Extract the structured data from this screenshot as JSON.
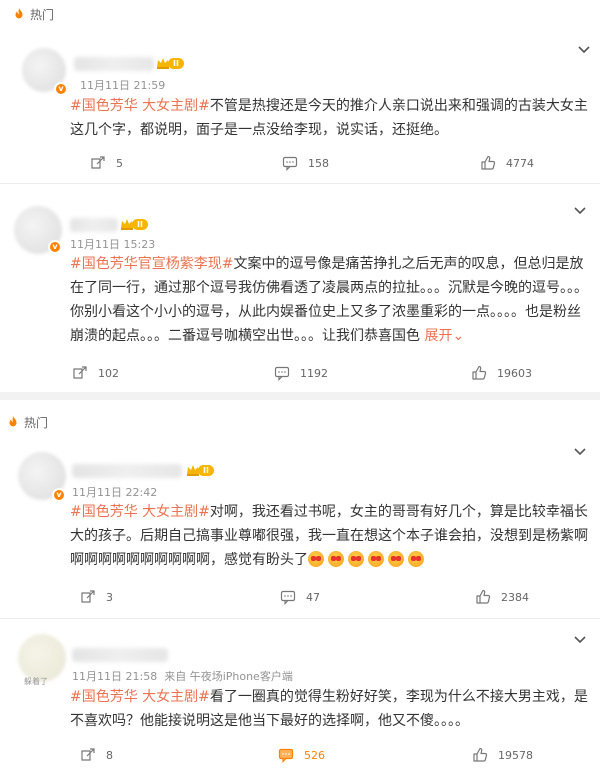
{
  "sections": [
    {
      "header": "热门",
      "comments": [
        {
          "time": "11月11日 21:59",
          "level": "II",
          "tag": "#国色芳华 大女主剧#",
          "text": "不管是热搜还是今天的推介人亲口说出来和强调的古装大女主这几个字，都说明，面子是一点没给李现，说实话，还挺绝。",
          "reposts": "5",
          "comments": "158",
          "likes": "4774"
        },
        {
          "time": "11月11日 15:23",
          "level": "II",
          "tag": "#国色芳华官宣杨紫李现#",
          "text": "文案中的逗号像是痛苦挣扎之后无声的叹息，但总归是放在了同一行，通过那个逗号我仿佛看透了凌晨两点的拉扯。。。沉默是今晚的逗号。。。你别小看这个小小的逗号，从此内娱番位史上又多了浓墨重彩的一点。。。。也是粉丝崩溃的起点。。。二番逗号咖横空出世。。。让我们恭喜国色",
          "expand": "展开",
          "reposts": "102",
          "comments": "1192",
          "likes": "19603"
        }
      ]
    },
    {
      "header": "热门",
      "comments": [
        {
          "time": "11月11日 22:42",
          "level": "II",
          "tag": "#国色芳华 大女主剧#",
          "text": "对啊，我还看过书呢，女主的哥哥有好几个，算是比较幸福长大的孩子。后期自己搞事业尊嘟很强，我一直在想这个本子谁会拍，没想到是杨紫啊啊啊啊啊啊啊啊啊啊啊，感觉有盼头了",
          "reposts": "3",
          "comments": "47",
          "likes": "2384"
        },
        {
          "time": "11月11日 21:58",
          "source": "来自 午夜场iPhone客户端",
          "avatar_caption": "躲着了",
          "tag": "#国色芳华 大女主剧#",
          "text": "看了一圈真的觉得生粉好好笑，李现为什么不接大男主戏，是不喜欢吗？他能接说明这是他当下最好的选择啊，他又不傻。。。。",
          "reposts": "8",
          "comments": "526",
          "likes": "19578"
        }
      ]
    }
  ],
  "colors": {
    "tag": "#eb7350",
    "accent": "#ff8200",
    "meta": "#939393"
  },
  "icons": [
    "flame-icon",
    "chevron-down-icon",
    "repost-icon",
    "comment-icon",
    "like-icon",
    "verified-badge-icon",
    "crown-icon"
  ]
}
